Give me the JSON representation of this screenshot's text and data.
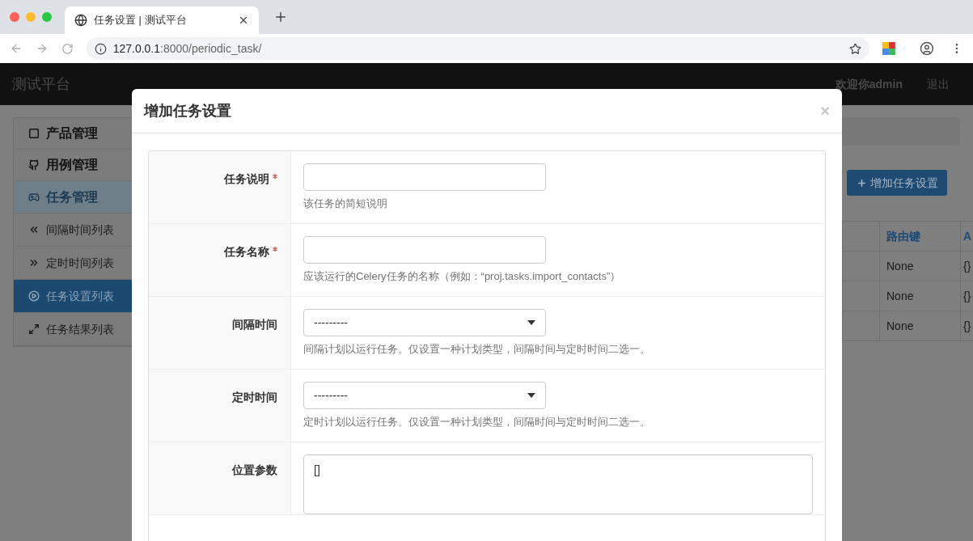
{
  "browser": {
    "tab_title": "任务设置 | 测试平台",
    "url_host": "127.0.0.1",
    "url_path": ":8000/periodic_task/"
  },
  "navbar": {
    "brand": "测试平台",
    "user": "欢迎你admin",
    "logout": "退出"
  },
  "sidebar": {
    "items": [
      {
        "label": "产品管理",
        "kind": "group",
        "expanded": false
      },
      {
        "label": "用例管理",
        "kind": "group",
        "expanded": false
      },
      {
        "label": "任务管理",
        "kind": "group",
        "expanded": true
      },
      {
        "label": "间隔时间列表",
        "kind": "link",
        "selected": false
      },
      {
        "label": "定时时间列表",
        "kind": "link",
        "selected": false
      },
      {
        "label": "任务设置列表",
        "kind": "link",
        "selected": true
      },
      {
        "label": "任务结果列表",
        "kind": "link",
        "selected": false
      }
    ]
  },
  "page": {
    "add_button": "增加任务设置",
    "table": {
      "columns": [
        "",
        "路由键",
        "A"
      ],
      "rows": [
        [
          "",
          "None",
          "{}"
        ],
        [
          "",
          "None",
          "{}"
        ],
        [
          "",
          "None",
          "{}"
        ]
      ]
    }
  },
  "modal": {
    "title": "增加任务设置",
    "close": "×",
    "fields": [
      {
        "kind": "text",
        "label": "任务说明",
        "required": true,
        "help": "该任务的简短说明"
      },
      {
        "kind": "text",
        "label": "任务名称",
        "required": true,
        "help": "应该运行的Celery任务的名称（例如：“proj.tasks.import_contacts”）"
      },
      {
        "kind": "select",
        "label": "间隔时间",
        "required": false,
        "value": "---------",
        "help": "间隔计划以运行任务。仅设置一种计划类型，间隔时间与定时时间二选一。"
      },
      {
        "kind": "select",
        "label": "定时时间",
        "required": false,
        "value": "---------",
        "help": "定时计划以运行任务。仅设置一种计划类型，间隔时间与定时时间二选一。"
      },
      {
        "kind": "textarea",
        "label": "位置参数",
        "required": false,
        "value": "[]"
      }
    ]
  }
}
